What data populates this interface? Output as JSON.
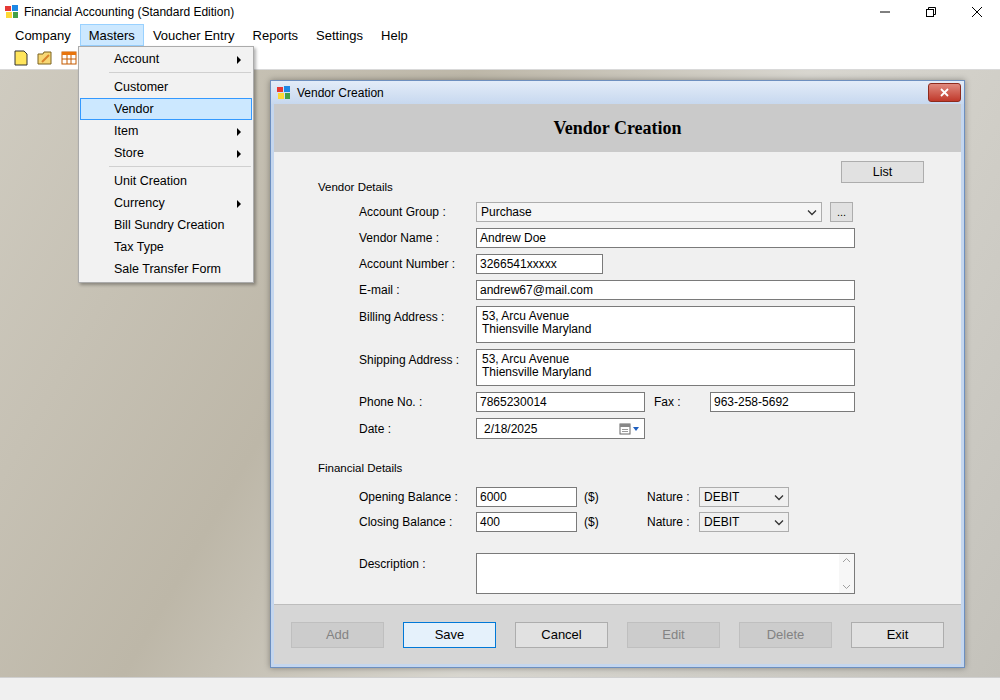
{
  "app": {
    "title": "Financial Accounting (Standard Edition)"
  },
  "menubar": [
    {
      "label": "Company",
      "selected": false
    },
    {
      "label": "Masters",
      "selected": true
    },
    {
      "label": "Voucher Entry",
      "selected": false
    },
    {
      "label": "Reports",
      "selected": false
    },
    {
      "label": "Settings",
      "selected": false
    },
    {
      "label": "Help",
      "selected": false
    }
  ],
  "masters_menu": [
    {
      "kind": "item",
      "label": "Account",
      "submenu": true,
      "selected": false
    },
    {
      "kind": "separator"
    },
    {
      "kind": "item",
      "label": "Customer",
      "submenu": false,
      "selected": false
    },
    {
      "kind": "item",
      "label": "Vendor",
      "submenu": false,
      "selected": true
    },
    {
      "kind": "item",
      "label": "Item",
      "submenu": true,
      "selected": false
    },
    {
      "kind": "item",
      "label": "Store",
      "submenu": true,
      "selected": false
    },
    {
      "kind": "separator"
    },
    {
      "kind": "item",
      "label": "Unit Creation",
      "submenu": false,
      "selected": false
    },
    {
      "kind": "item",
      "label": "Currency",
      "submenu": true,
      "selected": false
    },
    {
      "kind": "item",
      "label": "Bill Sundry Creation",
      "submenu": false,
      "selected": false
    },
    {
      "kind": "item",
      "label": "Tax Type",
      "submenu": false,
      "selected": false
    },
    {
      "kind": "item",
      "label": "Sale Transfer Form",
      "submenu": false,
      "selected": false
    }
  ],
  "dialog": {
    "title": "Vendor Creation",
    "heading": "Vendor Creation",
    "list_button": "List",
    "vendor_details": {
      "label": "Vendor Details",
      "rows": [
        {
          "kind": "select",
          "label": "Account Group :",
          "value": "Purchase",
          "browse": "..."
        },
        {
          "kind": "text",
          "label": "Vendor Name :",
          "value": "Andrew Doe"
        },
        {
          "kind": "short",
          "label": "Account Number :",
          "value": "3266541xxxxx"
        },
        {
          "kind": "text",
          "label": "E-mail :",
          "value": "andrew67@mail.com"
        },
        {
          "kind": "multiline",
          "label": "Billing Address :",
          "lines": [
            "53, Arcu Avenue",
            "Thiensville Maryland"
          ]
        },
        {
          "kind": "multiline",
          "label": "Shipping Address :",
          "lines": [
            "53, Arcu Avenue",
            "Thiensville Maryland"
          ]
        },
        {
          "kind": "pair",
          "label": "Phone No. :",
          "value": "7865230014",
          "second_label": "Fax :",
          "second_value": "963-258-5692"
        },
        {
          "kind": "date",
          "label": "Date :",
          "value": "2/18/2025"
        }
      ]
    },
    "financial_details": {
      "label": "Financial Details",
      "rows": [
        {
          "label": "Opening Balance :",
          "value": "6000",
          "unit": "($)",
          "nature_label": "Nature :",
          "nature": "DEBIT"
        },
        {
          "label": "Closing Balance :",
          "value": "400",
          "unit": "($)",
          "nature_label": "Nature :",
          "nature": "DEBIT"
        }
      ],
      "description": {
        "label": "Description :",
        "value": ""
      }
    },
    "buttons": [
      {
        "label": "Add",
        "disabled": true,
        "selected": false
      },
      {
        "label": "Save",
        "disabled": false,
        "selected": true
      },
      {
        "label": "Cancel",
        "disabled": false,
        "selected": false
      },
      {
        "label": "Edit",
        "disabled": true,
        "selected": false
      },
      {
        "label": "Delete",
        "disabled": true,
        "selected": false
      },
      {
        "label": "Exit",
        "disabled": false,
        "selected": false
      }
    ]
  }
}
